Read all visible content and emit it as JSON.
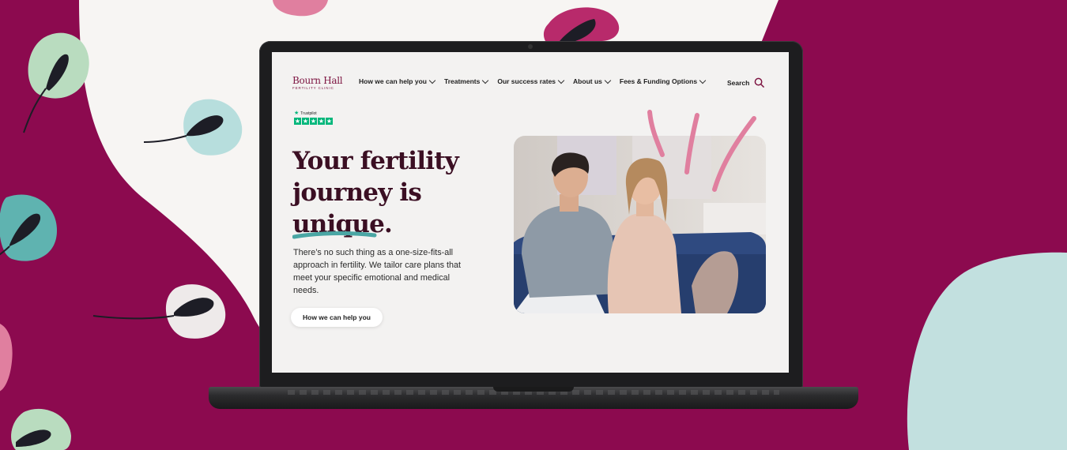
{
  "site": {
    "logo": {
      "name": "Bourn Hall",
      "subtitle": "FERTILITY CLINIC"
    },
    "nav": [
      {
        "label": "How we can help you"
      },
      {
        "label": "Treatments"
      },
      {
        "label": "Our success rates"
      },
      {
        "label": "About us"
      },
      {
        "label": "Fees & Funding Options"
      }
    ],
    "search_label": "Search",
    "trustpilot": {
      "label": "Trustpilot",
      "stars": 5
    },
    "hero": {
      "title_lines": [
        "Your fertility",
        "journey is",
        "unique."
      ],
      "body": "There’s no such thing as a one-size-fits-all approach in fertility. We tailor care plans that meet your specific emotional and medical needs.",
      "cta_label": "How we can help you"
    }
  },
  "colors": {
    "background": "#8c0a4f",
    "brand": "#7d1441",
    "title": "#3b0f23",
    "accent_teal": "#4aa6a4",
    "accent_pink": "#e07f9f",
    "trustpilot_green": "#00b67a"
  },
  "icons": {
    "search": "magnifier-icon",
    "chevron": "chevron-down-icon",
    "star": "star-icon"
  }
}
